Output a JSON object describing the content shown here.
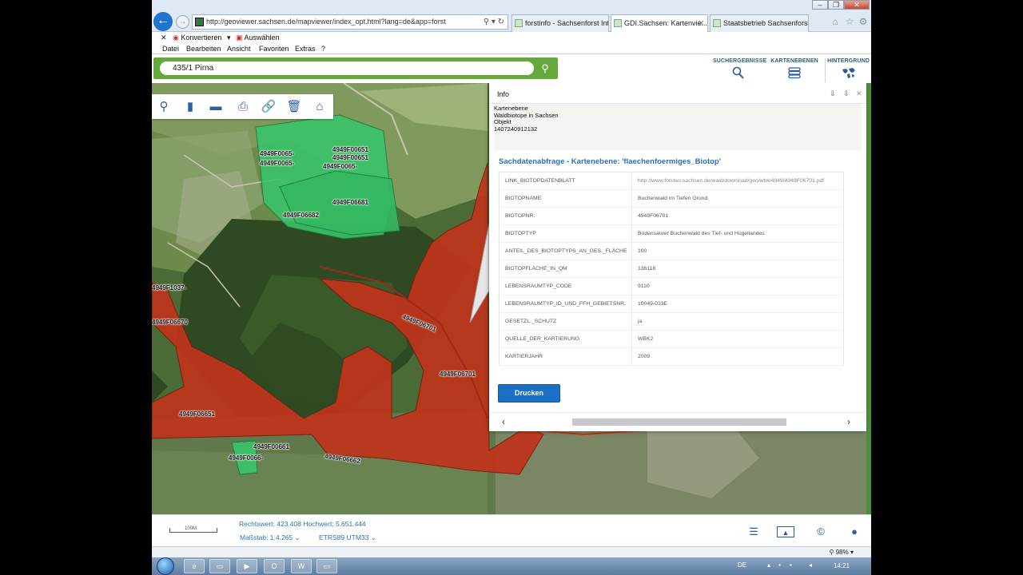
{
  "browser": {
    "address": "http://geoviewer.sachsen.de/mapviewer/index_opt.html?lang=de&app=forst",
    "tabs": [
      "forstinfo - Sachsenforst Int...",
      "GDI.Sachsen: Kartenvie...",
      "Staatsbetrieb Sachsenforst"
    ],
    "command_bar": {
      "convert": "Konvertieren",
      "select": "Auswählen"
    },
    "menu": [
      "Datei",
      "Bearbeiten",
      "Ansicht",
      "Favoriten",
      "Extras",
      "?"
    ],
    "zoom": "98%"
  },
  "app": {
    "search": {
      "value": "435/1 Pirna"
    },
    "header_buttons": [
      {
        "label": "SUCHERGEBNISSE",
        "icon": "search-results-icon"
      },
      {
        "label": "KARTENEBENEN",
        "icon": "layers-icon"
      },
      {
        "label": "HINTERGRUND",
        "icon": "world-map-icon"
      }
    ],
    "map_tools": [
      "zoom-search-icon",
      "bookmark-icon",
      "measure-icon",
      "print-icon",
      "link-icon",
      "delete-icon",
      "home-icon"
    ],
    "map_labels": [
      "4949F0065-",
      "4949F0065-",
      "4949F00651",
      "4949F00651",
      "4949F0065-",
      "4949F06681",
      "4949F06682",
      "4949F1037-",
      "4949F06670",
      "4949F06701",
      "4949F06701",
      "4949F06651",
      "4949F00661",
      "4949F0066-",
      "4949F06662"
    ],
    "info_panel": {
      "title": "Info",
      "layer_caption": "Kartenebene",
      "layer_name": "Waldbiotope in Sachsen",
      "object_caption": "Objekt",
      "object_id": "1407240912132",
      "section_title": "Sachdatenabfrage - Kartenebene: 'flaechenfoermiges_Biotop'",
      "attributes": [
        {
          "key": "LINK_BIOTOPDATENBLATT",
          "value": "http://www.forsten.sachsen.de/wald/download/geo/wbk/4949/4949F06701.pdf"
        },
        {
          "key": "BIOTOPNAME",
          "value": "Buchenwald im Tiefen Grund"
        },
        {
          "key": "BIOTOPNR.",
          "value": "4949F06701"
        },
        {
          "key": "BIOTOPTYP",
          "value": "Bodensaurer  Buchenwald des Tief- und Hügellandes"
        },
        {
          "key": "ANTEIL_DES_BIOTOPTYPS_AN_GES._FLÄCHE",
          "value": "100"
        },
        {
          "key": "BIOTOPFLÄCHE_in_qm",
          "value": "136118"
        },
        {
          "key": "LEBENSRAUMTYP_CODE",
          "value": "9110"
        },
        {
          "key": "LEBENSRAUMTYP_ID_UND_FFH_GEBIETSNR.",
          "value": "10049-033E"
        },
        {
          "key": "GESETZL._SCHUTZ",
          "value": "ja"
        },
        {
          "key": "QUELLE_DER_KARTIERUNG",
          "value": "WBK2"
        },
        {
          "key": "KARTIERJAHR",
          "value": "2009"
        }
      ],
      "print_label": "Drucken"
    },
    "status": {
      "scale_bar": "100M",
      "coords": "Rechtswert: 423.408 Hochwert: 5.651.444",
      "scale": "Maßstab: 1:4.265",
      "crs": "ETRS89 UTM33"
    }
  },
  "taskbar": {
    "lang": "DE",
    "time": "14:21"
  },
  "colors": {
    "accent": "#2f6fb5",
    "search_green": "#65a83b",
    "biotope_red": "#c0341a",
    "biotope_green": "#39c46a"
  }
}
